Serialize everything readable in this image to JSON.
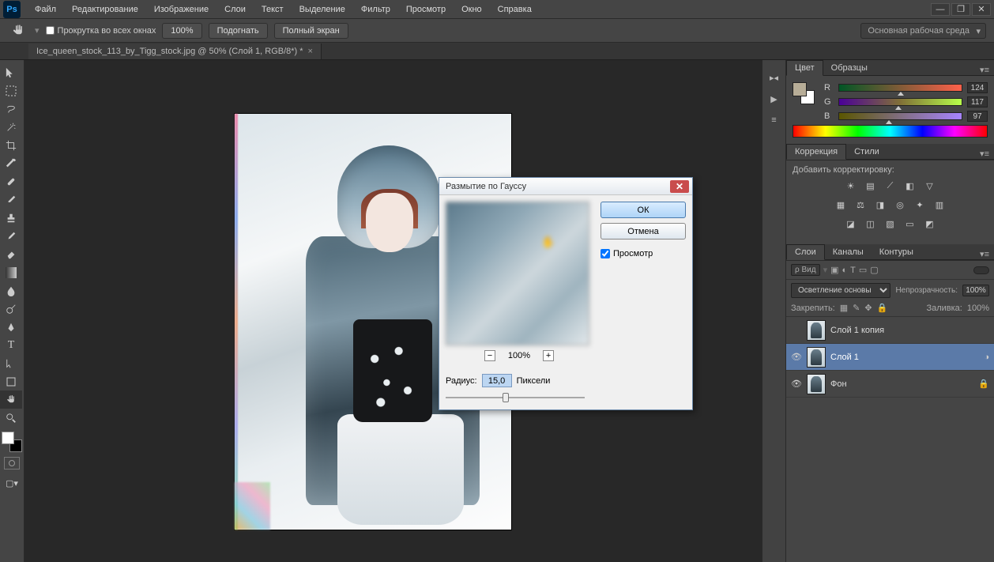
{
  "menu": {
    "items": [
      "Файл",
      "Редактирование",
      "Изображение",
      "Слои",
      "Текст",
      "Выделение",
      "Фильтр",
      "Просмотр",
      "Окно",
      "Справка"
    ]
  },
  "options": {
    "scroll_all_windows": "Прокрутка во всех окнах",
    "zoom": "100%",
    "fit": "Подогнать",
    "fullscreen": "Полный экран",
    "workspace": "Основная рабочая среда"
  },
  "document": {
    "tab_title": "Ice_queen_stock_113_by_Tigg_stock.jpg @ 50% (Слой 1, RGB/8*) *"
  },
  "dialog": {
    "title": "Размытие по Гауссу",
    "ok": "ОК",
    "cancel": "Отмена",
    "preview": "Просмотр",
    "preview_checked": true,
    "zoom_value": "100%",
    "radius_label": "Радиус:",
    "radius_value": "15,0",
    "radius_unit": "Пиксели"
  },
  "panels": {
    "color_tab": "Цвет",
    "swatches_tab": "Образцы",
    "rgb": {
      "r_label": "R",
      "r_val": "124",
      "g_label": "G",
      "g_val": "117",
      "b_label": "B",
      "b_val": "97"
    },
    "adjustments_tab": "Коррекция",
    "styles_tab": "Стили",
    "adjustments_hint": "Добавить корректировку:",
    "layers_tab": "Слои",
    "channels_tab": "Каналы",
    "paths_tab": "Контуры",
    "filter_kind": "ρ Вид",
    "blend_mode": "Осветление основы",
    "opacity_label": "Непрозрачность:",
    "opacity_value": "100%",
    "lock_label": "Закрепить:",
    "fill_label": "Заливка:",
    "fill_value": "100%",
    "layers": [
      {
        "name": "Слой 1 копия",
        "visible": false,
        "locked": false,
        "selected": false
      },
      {
        "name": "Слой 1",
        "visible": true,
        "locked": false,
        "selected": true
      },
      {
        "name": "Фон",
        "visible": true,
        "locked": true,
        "selected": false
      }
    ]
  }
}
